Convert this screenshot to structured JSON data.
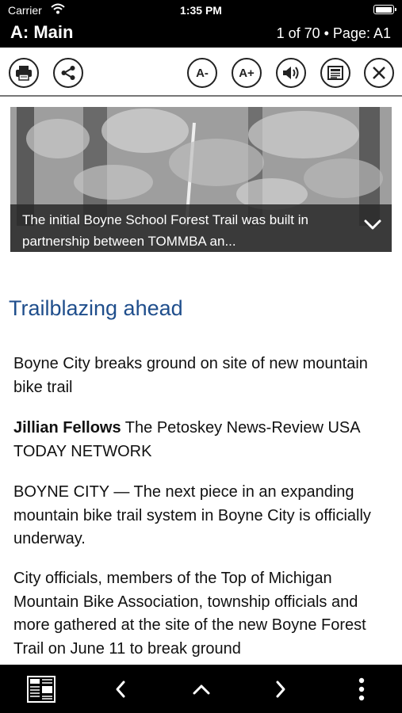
{
  "status": {
    "carrier": "Carrier",
    "time": "1:35 PM"
  },
  "header": {
    "section": "A: Main",
    "page_info": "1 of 70 • Page: A1"
  },
  "toolbar": {
    "print_icon": "printer-icon",
    "share_icon": "share-icon",
    "font_decrease_label": "A-",
    "font_increase_label": "A+",
    "audio_icon": "speaker-icon",
    "page_view_icon": "page-view-icon",
    "close_icon": "close-icon"
  },
  "photo": {
    "caption": "The initial Boyne School Forest Trail was built in partnership between TOMMBA an..."
  },
  "article": {
    "headline": "Trailblazing ahead",
    "subhead": "Boyne City breaks ground on site of new mountain bike trail",
    "byline_name": "Jillian Fellows",
    "byline_rest": " The Petoskey News-Review USA TODAY NETWORK",
    "para1": "BOYNE CITY — The next piece in an expanding mountain bike trail system in Boyne City is officially underway.",
    "para2": "City officials, members of the Top of Michigan Mountain Bike Association, township officials and more gathered at the site of the new Boyne Forest Trail on June 11 to break ground"
  },
  "bottom_nav": {
    "pages_icon": "newspaper-pages-icon",
    "prev_icon": "chevron-left-icon",
    "up_icon": "chevron-up-icon",
    "next_icon": "chevron-right-icon",
    "more_icon": "more-vertical-icon"
  }
}
